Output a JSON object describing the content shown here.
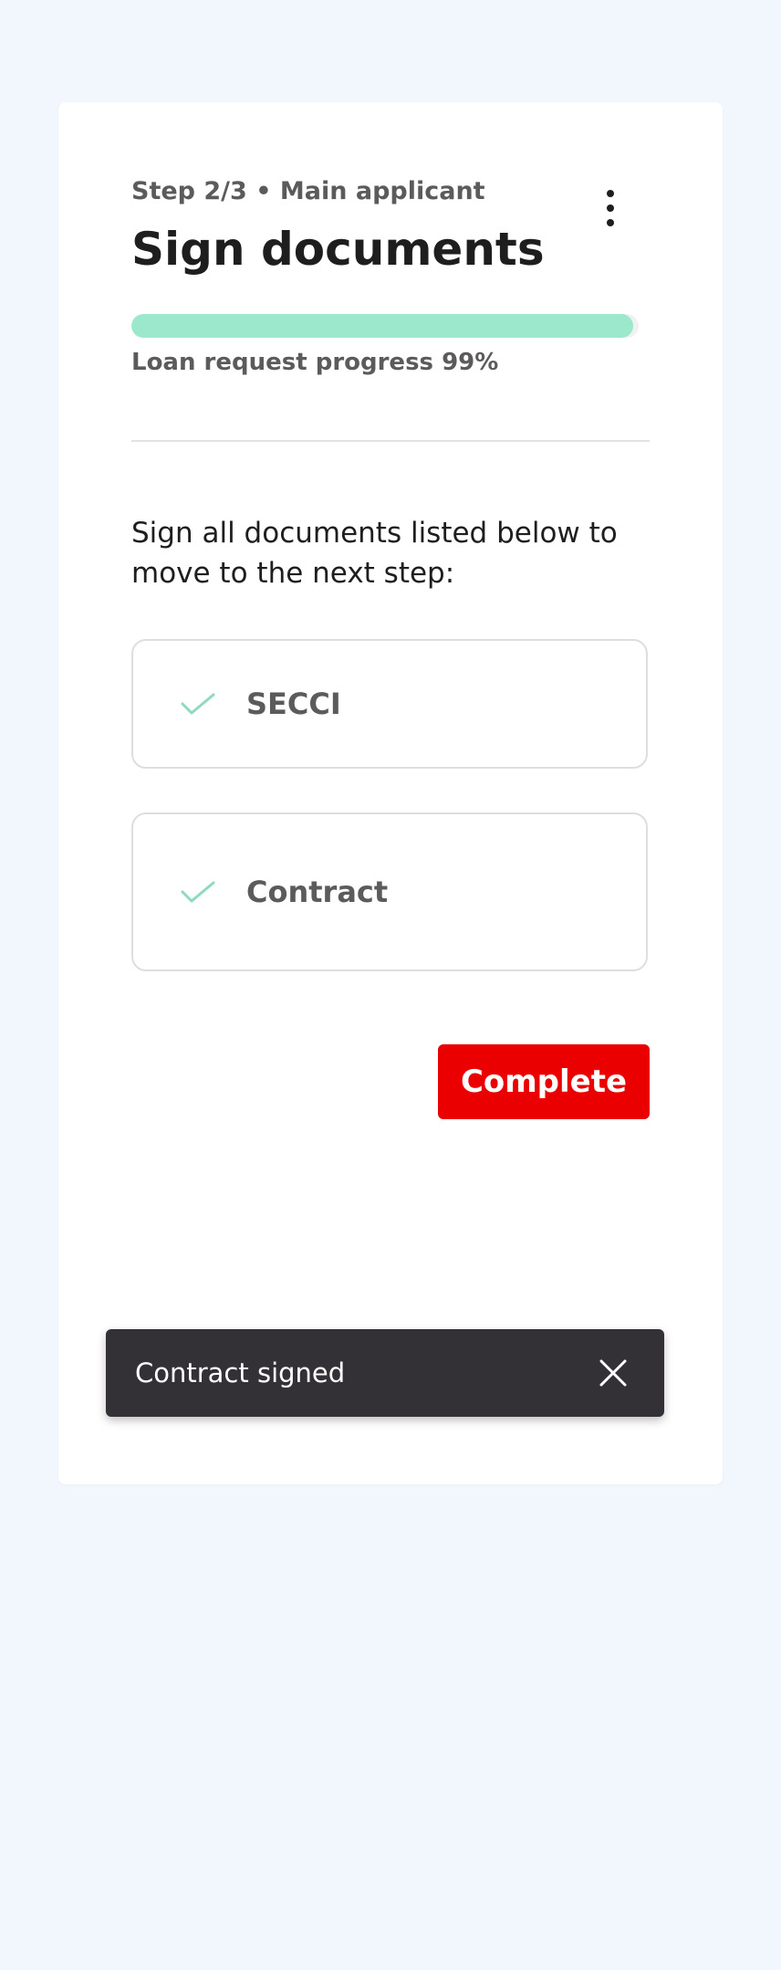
{
  "header": {
    "step_label": "Step 2/3 • Main applicant",
    "title": "Sign documents",
    "menu_icon": "kebab-menu-icon"
  },
  "progress": {
    "value": 0.99,
    "label": "Loan request progress 99%",
    "color": "#9ce8cc"
  },
  "instructions": "Sign all documents listed below to move to the next step:",
  "documents": [
    {
      "label": "SECCI",
      "status_icon": "check-icon"
    },
    {
      "label": "Contract",
      "status_icon": "check-icon"
    }
  ],
  "actions": {
    "complete_label": "Complete",
    "complete_color": "#ea0000"
  },
  "toast": {
    "message": "Contract signed",
    "close_icon": "close-icon"
  },
  "colors": {
    "background": "#f1f7fd",
    "check": "#8fd9c0",
    "toast_background": "#333136"
  }
}
